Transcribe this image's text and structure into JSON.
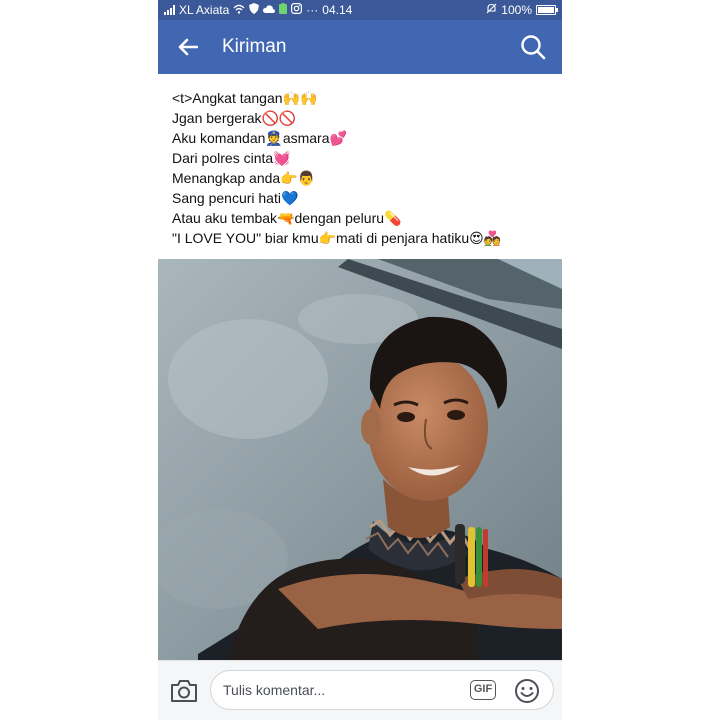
{
  "status_bar": {
    "carrier": "XL Axiata",
    "dots": "···",
    "time": "04.14",
    "battery_percent": "100%",
    "battery_level": 1.0
  },
  "app_bar": {
    "title": "Kiriman",
    "back_icon": "arrow-left-icon",
    "search_icon": "search-icon"
  },
  "post": {
    "lines": [
      "<t>Angkat tangan🙌🙌",
      "Jgan bergerak🚫🚫",
      "Aku komandan👮asmara💕",
      "Dari polres cinta💓",
      "Menangkap anda👉👨",
      "Sang pencuri hati💙",
      "Atau aku tembak🔫dengan peluru💊",
      "\"I LOVE YOU\" biar kmu👉mati di penjara hatiku😍💑"
    ]
  },
  "comment_bar": {
    "placeholder": "Tulis komentar...",
    "gif_label": "GIF",
    "camera_icon": "camera-icon",
    "emoji_icon": "smiley-icon"
  },
  "colors": {
    "status_bar": "#3b5998",
    "app_bar": "#4267b2",
    "comment_bar": "#f5f6f7"
  }
}
